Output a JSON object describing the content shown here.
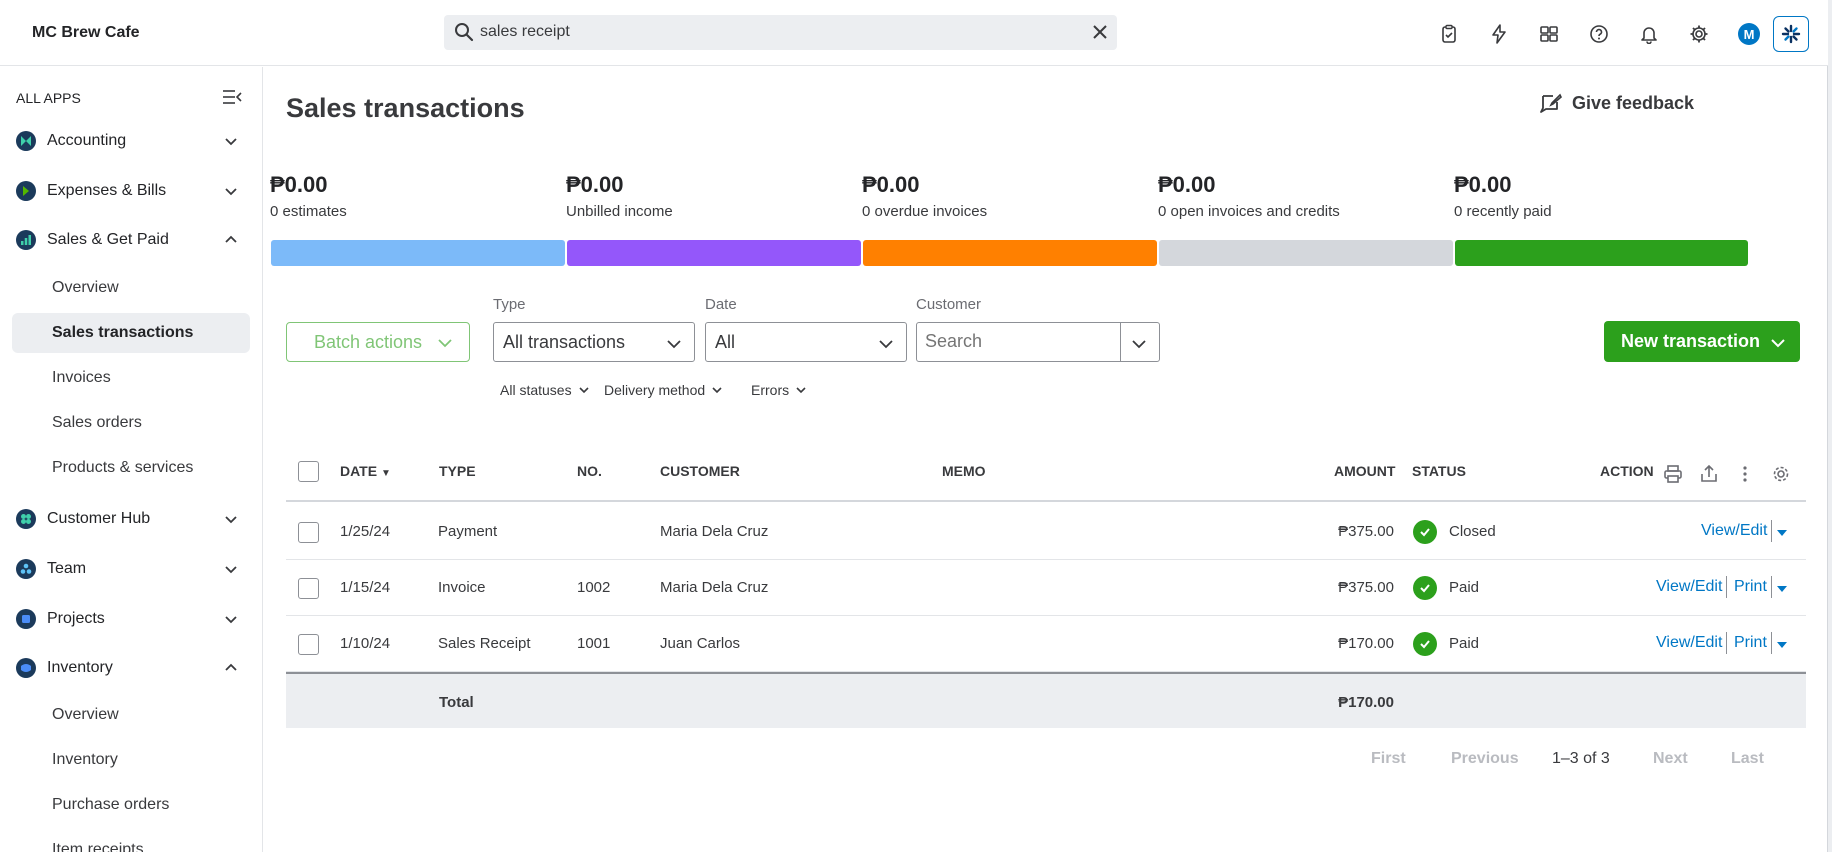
{
  "company": "MC Brew Cafe",
  "search": {
    "value": "sales receipt",
    "placeholder": ""
  },
  "topbar": {
    "avatar_letter": "M"
  },
  "sidebar": {
    "all_apps": "ALL APPS",
    "items": [
      {
        "label": "Accounting",
        "color": "#1b3a5b"
      },
      {
        "label": "Expenses & Bills",
        "color": "#1b3a5b"
      },
      {
        "label": "Sales & Get Paid",
        "color": "#1b3a5b"
      },
      {
        "label": "Customer Hub",
        "color": "#1b3a5b"
      },
      {
        "label": "Team",
        "color": "#1b3a5b"
      },
      {
        "label": "Projects",
        "color": "#1b3a5b"
      },
      {
        "label": "Inventory",
        "color": "#1b3a5b"
      }
    ],
    "sales_sub": [
      "Overview",
      "Sales transactions",
      "Invoices",
      "Sales orders",
      "Products & services"
    ],
    "inventory_sub": [
      "Overview",
      "Inventory",
      "Purchase orders",
      "Item receipts"
    ]
  },
  "page": {
    "title": "Sales transactions",
    "feedback": "Give feedback"
  },
  "money_bar": [
    {
      "amount": "₱0.00",
      "label": "0 estimates",
      "color": "#7cbaf9"
    },
    {
      "amount": "₱0.00",
      "label": "Unbilled income",
      "color": "#9457fa"
    },
    {
      "amount": "₱0.00",
      "label": "0 overdue invoices",
      "color": "#ff8000"
    },
    {
      "amount": "₱0.00",
      "label": "0 open invoices and credits",
      "color": "#d4d7dc"
    },
    {
      "amount": "₱0.00",
      "label": "0 recently paid",
      "color": "#2ca01c"
    }
  ],
  "filters": {
    "batch": "Batch actions",
    "type_label": "Type",
    "type_value": "All transactions",
    "date_label": "Date",
    "date_value": "All",
    "customer_label": "Customer",
    "customer_placeholder": "Search",
    "new_tx": "New transaction",
    "statuses": "All statuses",
    "delivery": "Delivery method",
    "errors": "Errors"
  },
  "table": {
    "headers": {
      "date": "DATE",
      "type": "TYPE",
      "no": "NO.",
      "customer": "CUSTOMER",
      "memo": "MEMO",
      "amount": "AMOUNT",
      "status": "STATUS",
      "action": "ACTION"
    },
    "rows": [
      {
        "date": "1/25/24",
        "type": "Payment",
        "no": "",
        "customer": "Maria Dela Cruz",
        "memo": "",
        "amount": "₱375.00",
        "status": "Closed",
        "view": "View/Edit",
        "print": ""
      },
      {
        "date": "1/15/24",
        "type": "Invoice",
        "no": "1002",
        "customer": "Maria Dela Cruz",
        "memo": "",
        "amount": "₱375.00",
        "status": "Paid",
        "view": "View/Edit",
        "print": "Print"
      },
      {
        "date": "1/10/24",
        "type": "Sales Receipt",
        "no": "1001",
        "customer": "Juan Carlos",
        "memo": "",
        "amount": "₱170.00",
        "status": "Paid",
        "view": "View/Edit",
        "print": "Print"
      }
    ],
    "total_label": "Total",
    "total_amount": "₱170.00"
  },
  "pager": {
    "first": "First",
    "previous": "Previous",
    "range": "1–3 of 3",
    "next": "Next",
    "last": "Last"
  }
}
